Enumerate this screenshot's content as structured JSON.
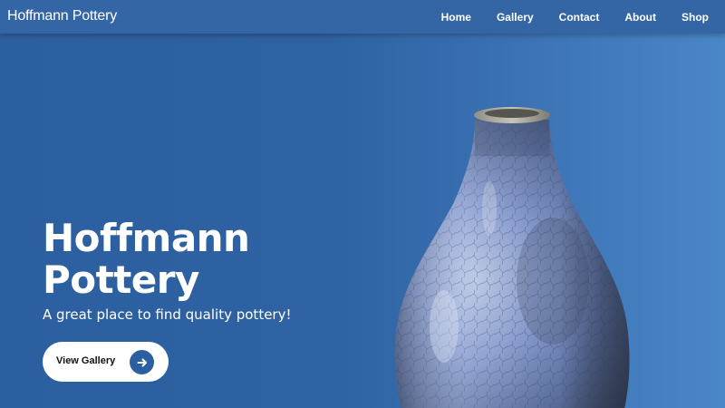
{
  "nav": {
    "brand": "Hoffmann Pottery",
    "links": [
      {
        "label": "Home"
      },
      {
        "label": "Gallery"
      },
      {
        "label": "Contact"
      },
      {
        "label": "About"
      },
      {
        "label": "Shop"
      }
    ]
  },
  "hero": {
    "title_line1": "Hoffmann",
    "title_line2": "Pottery",
    "subtitle": "A great place to find quality pottery!",
    "cta_label": "View Gallery",
    "cta_icon": "arrow-right-icon",
    "image": "blue-glazed-vase"
  },
  "colors": {
    "background": "#2f63a3",
    "navbar": "#3466a6",
    "cta_background": "#ffffff",
    "cta_icon_circle": "#2c5f9f",
    "text": "#ffffff"
  }
}
